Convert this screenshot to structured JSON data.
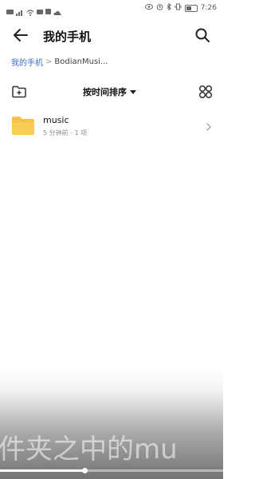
{
  "status_bar": {
    "time": "7:26",
    "icons_left": [
      "hd-icon",
      "signal-icon",
      "wifi-icon",
      "video-icon",
      "notification-icon",
      "cloud-icon"
    ],
    "icons_right": [
      "eye-icon",
      "alarm-icon",
      "bluetooth-icon",
      "vibrate-icon",
      "battery-icon"
    ]
  },
  "header": {
    "title": "我的手机",
    "back_icon": "back-arrow-icon",
    "search_icon": "search-icon"
  },
  "breadcrumb": {
    "home": "我的手机",
    "separator": ">",
    "current": "BodianMusi..."
  },
  "toolbar": {
    "sort_label": "按时间排序",
    "new_folder_icon": "new-folder-icon",
    "view_toggle_icon": "grid-view-icon"
  },
  "files": [
    {
      "name": "music",
      "meta": "5 分钟前 - 1 项",
      "icon": "folder-icon"
    }
  ],
  "video_overlay": {
    "caption": "件夹之中的mu",
    "progress": 0.38
  },
  "colors": {
    "accent": "#3b6fd4",
    "folder": "#f7c342"
  }
}
